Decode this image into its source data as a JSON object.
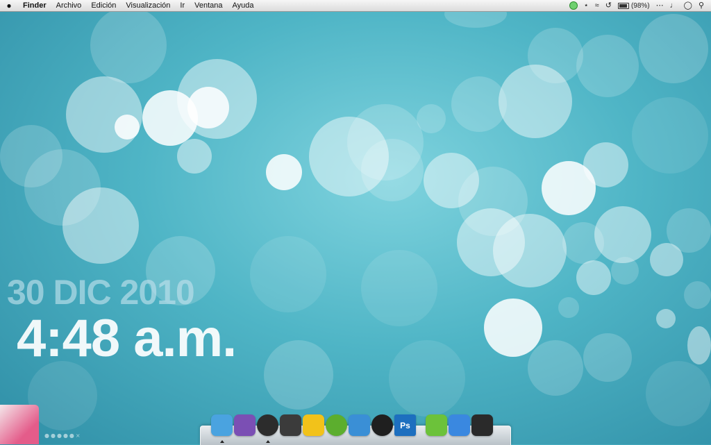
{
  "menubar": {
    "app_name": "Finder",
    "menus": [
      "Archivo",
      "Edición",
      "Visualización",
      "Ir",
      "Ventana",
      "Ayuda"
    ],
    "status": {
      "battery_percent": "(98%)",
      "icons": [
        "status-circle-icon",
        "bluetooth-icon",
        "wifi-icon",
        "time-machine-icon",
        "battery-icon",
        "keyboard-icon",
        "volume-icon",
        "clock-icon",
        "spotlight-icon"
      ]
    }
  },
  "desktop": {
    "date": "30 DIC 2010",
    "time": "4:48 a.m."
  },
  "dock": {
    "apps": [
      {
        "name": "finder-icon",
        "color": "#4aa3e0",
        "running": true
      },
      {
        "name": "adium-icon",
        "color": "#7b4fb4",
        "running": false
      },
      {
        "name": "itunes-icon",
        "color": "#2c2c2c",
        "running": true
      },
      {
        "name": "camera-icon",
        "color": "#3b3b3b",
        "running": false
      },
      {
        "name": "cyberduck-icon",
        "color": "#f2c21a",
        "running": false
      },
      {
        "name": "frog-app-icon",
        "color": "#5cae2e",
        "running": false
      },
      {
        "name": "messenger-icon",
        "color": "#3a8fd6",
        "running": false
      },
      {
        "name": "tuxedo-app-icon",
        "color": "#1f1f1f",
        "running": false
      },
      {
        "name": "photoshop-icon",
        "color": "#1d6fbf",
        "label": "Ps",
        "running": false
      },
      {
        "name": "stack-app-icon",
        "color": "#6cc23a",
        "running": false
      },
      {
        "name": "app-store-icon",
        "color": "#3a88e0",
        "running": false
      },
      {
        "name": "terminal-icon",
        "color": "#2a2a2a",
        "running": false
      }
    ]
  }
}
